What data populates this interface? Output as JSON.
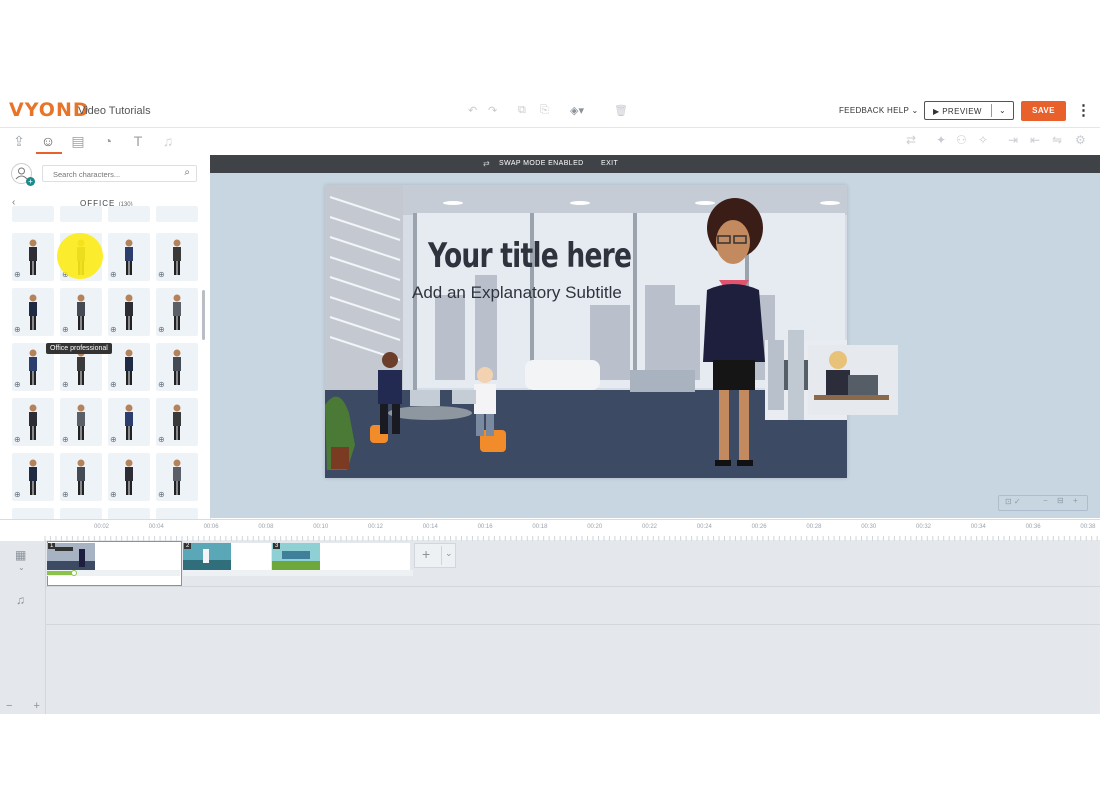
{
  "header": {
    "logo": "VYOND",
    "project_title": "Video Tutorials",
    "feedback_label": "FEEDBACK",
    "help_label": "HELP",
    "preview_label": "PREVIEW",
    "save_label": "SAVE"
  },
  "left_panel": {
    "search_placeholder": "Search characters...",
    "category_title": "OFFICE",
    "category_count": "(130)",
    "tooltip": "Office professional"
  },
  "swap_bar": {
    "mode_text": "SWAP MODE ENABLED",
    "exit_label": "EXIT"
  },
  "stage": {
    "title": "Your title here",
    "subtitle": "Add an Explanatory Subtitle"
  },
  "timeline": {
    "ticks": [
      "00:02",
      "00:04",
      "00:06",
      "00:08",
      "00:10",
      "00:12",
      "00:14",
      "00:16",
      "00:18",
      "00:20",
      "00:22",
      "00:24",
      "00:26",
      "00:28",
      "00:30",
      "00:32",
      "00:34",
      "00:36",
      "00:38"
    ],
    "scenes": [
      {
        "number": "1"
      },
      {
        "number": "2"
      },
      {
        "number": "3"
      }
    ]
  },
  "colors": {
    "accent": "#e8602c",
    "brand": "#e8742a",
    "highlight": "#fcec16",
    "swap_bar": "#3f4347"
  }
}
